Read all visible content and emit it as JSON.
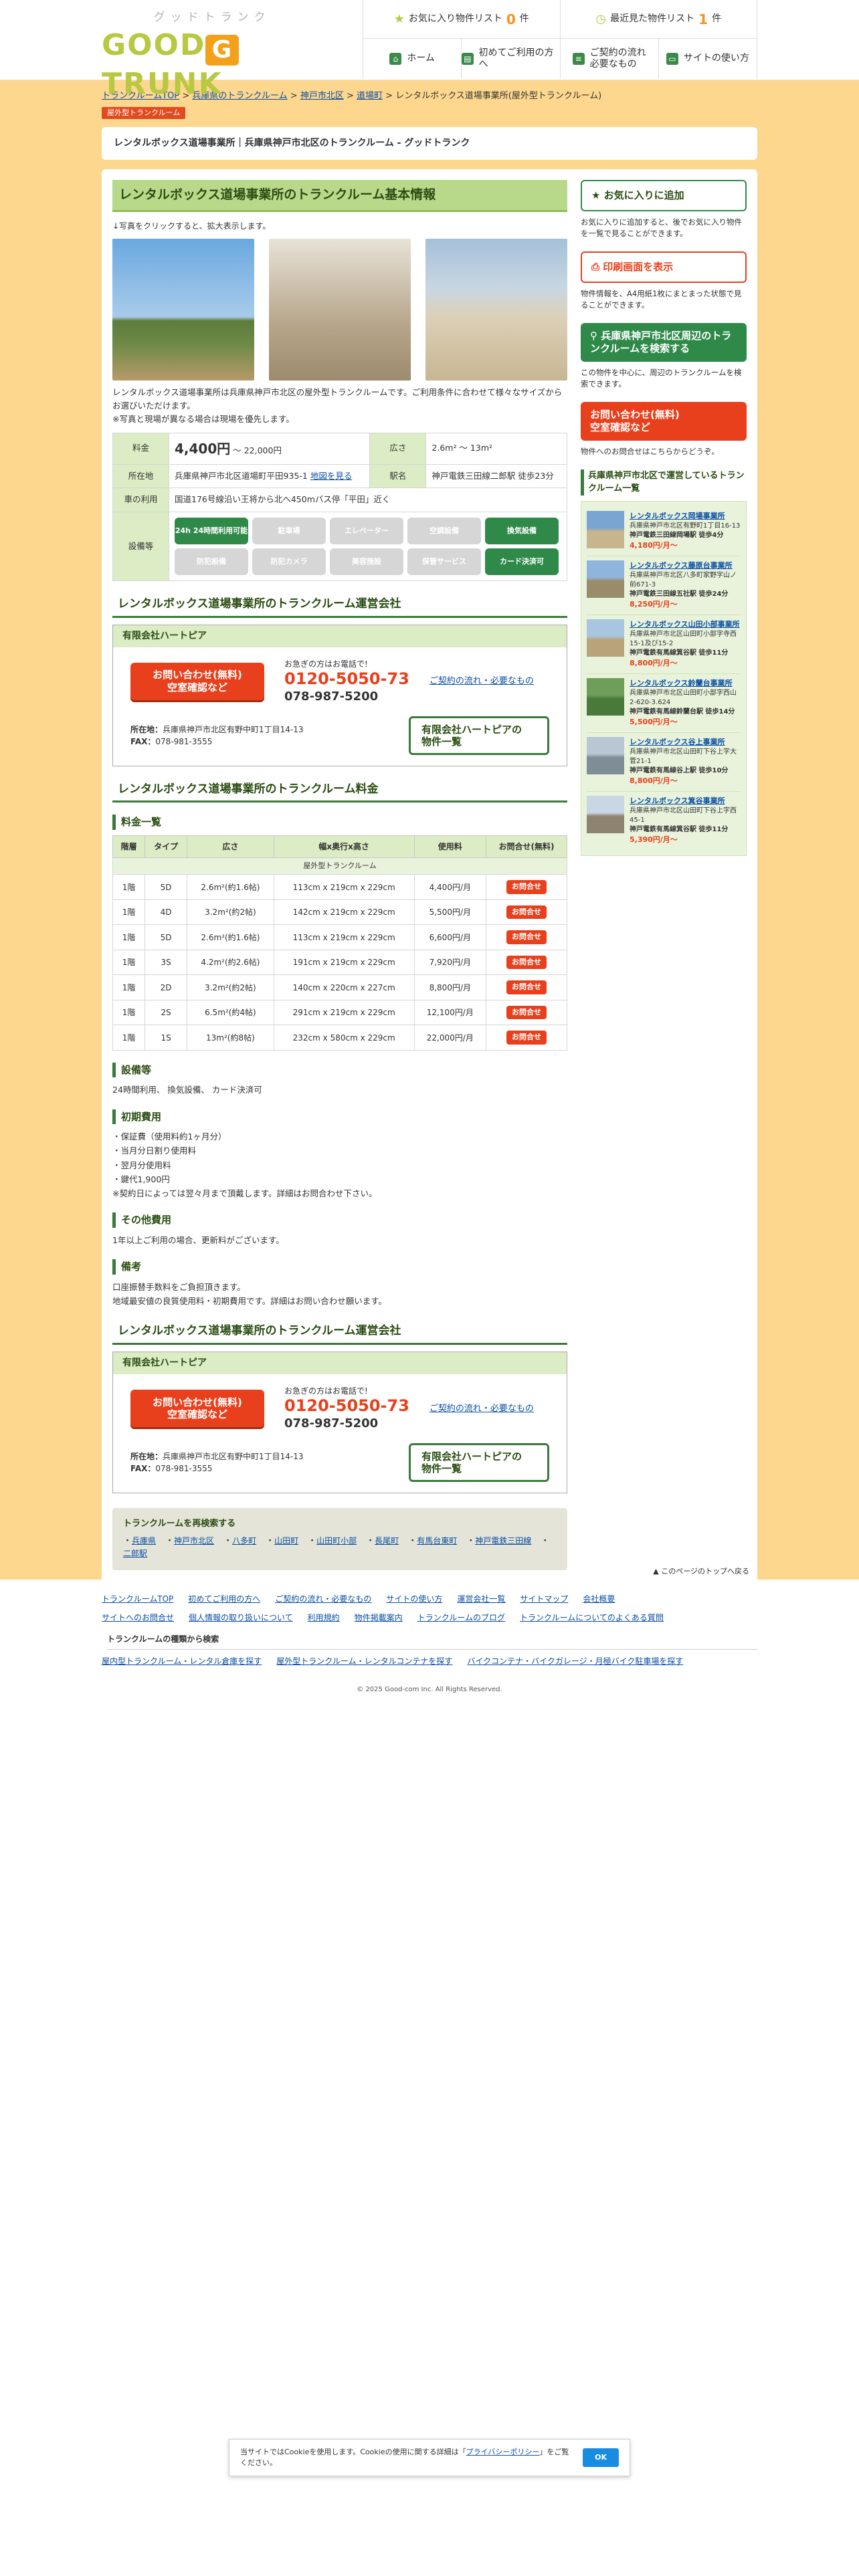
{
  "header": {
    "logo_sub": "グッドトランク",
    "logo_main_left": "GOOD",
    "logo_main_mid": "G",
    "logo_main_right": "TRUNK",
    "fav_label": "お気に入り物件リスト",
    "fav_count": "0",
    "fav_unit": "件",
    "recent_label": "最近見た物件リスト",
    "recent_count": "1",
    "recent_unit": "件",
    "nav": [
      "ホーム",
      "初めてご利用の方へ",
      "ご契約の流れ\n必要なもの",
      "サイトの使い方"
    ]
  },
  "breadcrumb": [
    "トランクルームTOP",
    "兵庫県のトランクルーム",
    "神戸市北区",
    "道場町",
    "レンタルボックス道場事業所(屋外型トランクルーム)"
  ],
  "badge": "屋外型トランクルーム",
  "title_line": {
    "name": "レンタルボックス道場事業所",
    "addr": "兵庫県神戸市北区のトランクルーム",
    "sep": " ‐ ",
    "brand": "グッドトランク"
  },
  "basic": {
    "heading": "レンタルボックス道場事業所のトランクルーム基本情報",
    "click_note": "↓写真をクリックすると、拡大表示します。",
    "desc1": "レンタルボックス道場事業所は兵庫県神戸市北区の屋外型トランクルームです。ご利用条件に合わせて様々なサイズからお選びいただけます。",
    "desc2": "※写真と現場が異なる場合は現場を優先します。",
    "rows": {
      "fee_label": "料金",
      "fee_price": "4,400円",
      "fee_to": "〜 22,000円",
      "size_label": "広さ",
      "size_val": "2.6m² 〜 13m²",
      "loc_label": "所在地",
      "loc_val": "兵庫県神戸市北区道場町平田935-1",
      "map_link": "地図を見る",
      "station_label": "駅名",
      "station_val": "神戸電鉄三田線二郎駅 徒歩23分",
      "access_label": "車の利用",
      "access_val": "国道176号線沿い王将から北へ450mバス停「平田」近く",
      "equip_label": "設備等"
    },
    "equip": [
      {
        "label": "24h 24時間利用可能",
        "on": true
      },
      {
        "label": "駐車場",
        "on": false
      },
      {
        "label": "エレベーター",
        "on": false
      },
      {
        "label": "空調設備",
        "on": false
      },
      {
        "label": "換気設備",
        "on": true
      },
      {
        "label": "防犯設備",
        "on": false
      },
      {
        "label": "防犯カメラ",
        "on": false
      },
      {
        "label": "美容施設",
        "on": false
      },
      {
        "label": "保管サービス",
        "on": false
      },
      {
        "label": "カード決済可",
        "on": true
      }
    ]
  },
  "operator": {
    "heading": "レンタルボックス道場事業所のトランクルーム運営会社",
    "company": "有限会社ハートピア",
    "inq_btn": "お問い合わせ(無料)\n空室確認など",
    "tel_lbl": "お急ぎの方はお電話で!",
    "tel_free": "0120-5050-73",
    "tel": "078-987-5200",
    "flow_link": "ご契約の流れ・必要なもの",
    "addr_lbl": "所在地：",
    "addr": "兵庫県神戸市北区有野中町1丁目14-13",
    "fax_lbl": "FAX：",
    "fax": "078-981-3555",
    "list_btn": "有限会社ハートピアの\n物件一覧"
  },
  "fees": {
    "heading": "レンタルボックス道場事業所のトランクルーム料金",
    "sub": "料金一覧",
    "cols": [
      "階層",
      "タイプ",
      "広さ",
      "幅x奥行x高さ",
      "使用料",
      "お問合せ(無料)"
    ],
    "band": "屋外型トランクルーム",
    "btn": "お問合せ",
    "rows": [
      [
        "1階",
        "5D",
        "2.6m²(約1.6帖)",
        "113cm x 219cm x 229cm",
        "4,400円/月"
      ],
      [
        "1階",
        "4D",
        "3.2m²(約2帖)",
        "142cm x 219cm x 229cm",
        "5,500円/月"
      ],
      [
        "1階",
        "5D",
        "2.6m²(約1.6帖)",
        "113cm x 219cm x 229cm",
        "6,600円/月"
      ],
      [
        "1階",
        "3S",
        "4.2m²(約2.6帖)",
        "191cm x 219cm x 229cm",
        "7,920円/月"
      ],
      [
        "1階",
        "2D",
        "3.2m²(約2帖)",
        "140cm x 220cm x 227cm",
        "8,800円/月"
      ],
      [
        "1階",
        "2S",
        "6.5m²(約4帖)",
        "291cm x 219cm x 229cm",
        "12,100円/月"
      ],
      [
        "1階",
        "1S",
        "13m²(約8帖)",
        "232cm x 580cm x 229cm",
        "22,000円/月"
      ]
    ]
  },
  "facility": {
    "h": "設備等",
    "t": "24時間利用、 換気設備、 カード決済可"
  },
  "initial": {
    "h": "初期費用",
    "lines": [
      "・保証費（使用料約1ヶ月分）",
      "・当月分日割り使用料",
      "・翌月分使用料",
      "・鍵代1,900円",
      "※契約日によっては翌々月まで頂戴します。詳細はお問合わせ下さい。"
    ]
  },
  "other": {
    "h": "その他費用",
    "t": "1年以上ご利用の場合、更新料がございます。"
  },
  "remarks": {
    "h": "備考",
    "lines": [
      "口座振替手数料をご負担頂きます。",
      "地域最安値の良質使用料・初期費用です。詳細はお問い合わせ願います。"
    ]
  },
  "operator2_heading": "レンタルボックス道場事業所のトランクルーム運営会社",
  "research": {
    "title": "トランクルームを再検索する",
    "links": [
      "兵庫県",
      "神戸市北区",
      "八多町",
      "山田町",
      "山田町小部",
      "長尾町",
      "有馬台東町",
      "神戸電鉄三田線",
      "二郎駅"
    ]
  },
  "sidebar": {
    "fav_btn": "お気に入りに追加",
    "fav_txt": "お気に入りに追加すると、後でお気に入り物件を一覧で見ることができます。",
    "print_btn": "印刷画面を表示",
    "print_txt": "物件情報を、A4用紙1枚にまとまった状態で見ることができます。",
    "search_btn": "兵庫県神戸市北区周辺のトランクルームを検索する",
    "search_txt": "この物件を中心に、周辺のトランクルームを検索できます。",
    "inq_btn": "お問い合わせ(無料)\n空室確認など",
    "inq_txt": "物件へのお問合せはこちらからどうぞ。",
    "nearby_h": "兵庫県神戸市北区で運営しているトランクルーム一覧",
    "nearby": [
      {
        "name": "レンタルボックス岡場事業所",
        "addr": "兵庫県神戸市北区有野町1丁目16-13",
        "st": "神戸電鉄三田線岡場駅 徒歩4分",
        "price": "4,180円/月〜",
        "c1": "#7aa4d1",
        "c2": "#c7b58d"
      },
      {
        "name": "レンタルボックス藤原台事業所",
        "addr": "兵庫県神戸市北区八多町家野字山ノ前671-3",
        "st": "神戸電鉄三田線五社駅 徒歩24分",
        "price": "8,250円/月〜",
        "c1": "#8fb5dc",
        "c2": "#9a8c6a"
      },
      {
        "name": "レンタルボックス山田小部事業所",
        "addr": "兵庫県神戸市北区山田町小部字寺西15-1及び15-2",
        "st": "神戸電鉄有馬線箕谷駅 徒歩11分",
        "price": "8,800円/月〜",
        "c1": "#a9c6e0",
        "c2": "#b9a37a"
      },
      {
        "name": "レンタルボックス鈴蘭台事業所",
        "addr": "兵庫県神戸市北区山田町小部字西山2-620-3.624",
        "st": "神戸電鉄有馬線鈴蘭台駅 徒歩14分",
        "price": "5,500円/月〜",
        "c1": "#6f9e5a",
        "c2": "#4a7a3b"
      },
      {
        "name": "レンタルボックス谷上事業所",
        "addr": "兵庫県神戸市北区山田町下谷上字大菅21-1",
        "st": "神戸電鉄有馬線谷上駅 徒歩10分",
        "price": "8,800円/月〜",
        "c1": "#b9c6d4",
        "c2": "#7f8d96"
      },
      {
        "name": "レンタルボックス箕谷事業所",
        "addr": "兵庫県神戸市北区山田町下谷上字西45-1",
        "st": "神戸電鉄有馬線箕谷駅 徒歩11分",
        "price": "5,390円/月〜",
        "c1": "#c9d6e3",
        "c2": "#8e8370"
      }
    ]
  },
  "to_top": "このページのトップへ戻る",
  "footer": {
    "links1": [
      "トランクルームTOP",
      "初めてご利用の方へ",
      "ご契約の流れ・必要なもの",
      "サイトの使い方",
      "運営会社一覧",
      "サイトマップ",
      "会社概要"
    ],
    "links2": [
      "サイトへのお問合せ",
      "個人情報の取り扱いについて",
      "利用規約",
      "物件掲載案内",
      "トランクルームのブログ",
      "トランクルームについてのよくある質問"
    ],
    "cap": "トランクルームの種類から検索",
    "links3": [
      "屋内型トランクルーム・レンタル倉庫を探す",
      "屋外型トランクルーム・レンタルコンテナを探す",
      "バイクコンテナ・バイクガレージ・月極バイク駐車場を探す"
    ],
    "copy": "© 2025 Good-com Inc. All Rights Reserved."
  },
  "cookie": {
    "text_a": "当サイトではCookieを使用します。Cookieの使用に関する詳細は「",
    "link": "プライバシーポリシー",
    "text_b": "」をご覧ください。",
    "ok": "OK"
  }
}
